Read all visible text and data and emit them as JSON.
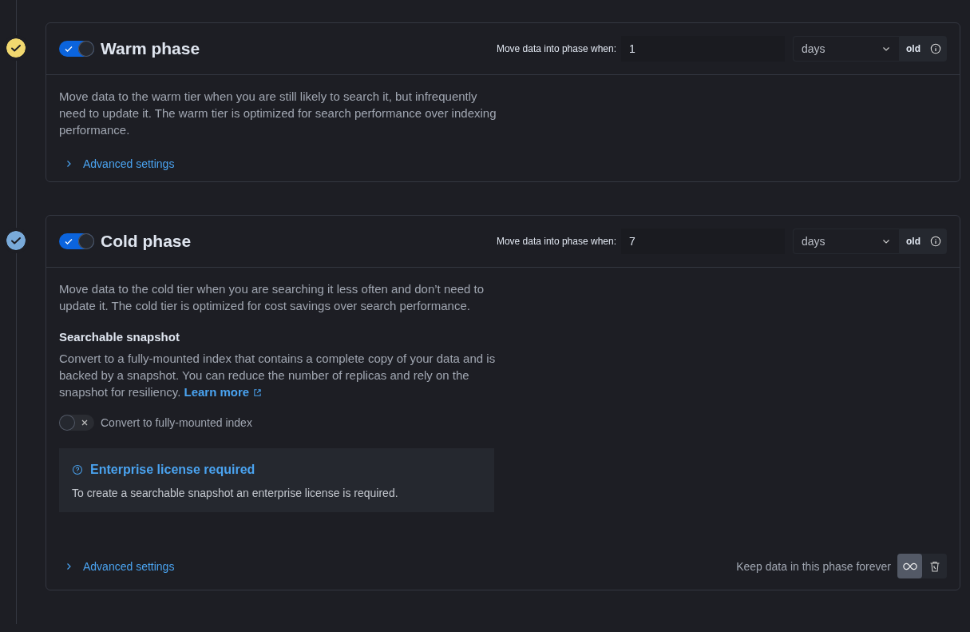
{
  "phases": [
    {
      "title": "Warm phase",
      "color": "#f1d86f",
      "enabled": true,
      "timing": {
        "label": "Move data into phase when:",
        "value": "1",
        "unit": "days",
        "suffix": "old"
      },
      "description": "Move data to the warm tier when you are still likely to search it, but infrequently need to update it. The warm tier is optimized for search performance over indexing performance.",
      "advanced": {
        "label": "Advanced settings",
        "expanded": false
      }
    },
    {
      "title": "Cold phase",
      "color": "#79aad9",
      "enabled": true,
      "timing": {
        "label": "Move data into phase when:",
        "value": "7",
        "unit": "days",
        "suffix": "old"
      },
      "description": "Move data to the cold tier when you are searching it less often and don’t need to update it. The cold tier is optimized for cost savings over search performance.",
      "snapshot": {
        "title": "Searchable snapshot",
        "text": "Convert to a fully-mounted index that contains a complete copy of your data and is backed by a snapshot. You can reduce the number of replicas and rely on the snapshot for resiliency.",
        "link": "Learn more",
        "switch": {
          "label": "Convert to fully-mounted index",
          "on": false
        },
        "callout": {
          "title": "Enterprise license required",
          "text": "To create a searchable snapshot an enterprise license is required."
        }
      },
      "advanced": {
        "label": "Advanced settings",
        "expanded": false
      },
      "keep_forever": {
        "label": "Keep data in this phase forever",
        "buttons": [
          {
            "kind": "infinity",
            "selected": true
          },
          {
            "kind": "trash",
            "selected": false
          }
        ]
      }
    }
  ]
}
